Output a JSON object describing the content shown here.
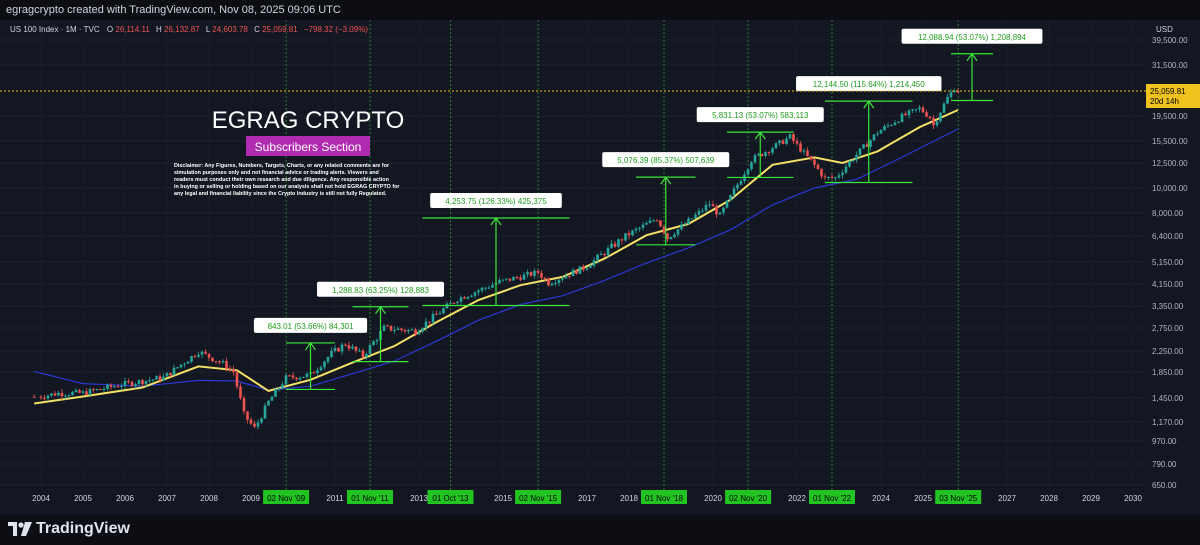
{
  "header": {
    "credit": "egragcrypto created with TradingView.com, Nov 08, 2025 09:06 UTC"
  },
  "legend": {
    "symbol": "US 100 Index · 1M · TVC",
    "o_key": "O",
    "o_val": "26,114.11",
    "h_key": "H",
    "h_val": "26,132.87",
    "l_key": "L",
    "l_val": "24,603.78",
    "c_key": "C",
    "c_val": "25,059.81",
    "chg": "−798.32 (−3.09%)"
  },
  "branding": {
    "title": "EGRAG CRYPTO",
    "badge": "Subscribers Section",
    "disclaimer": [
      "Disclaimer: Any Figures, Numbers, Targets, Charts, or any related comments are for",
      "simulation purposes only and not financial advice or trading alerts. Viewers and",
      "readers must conduct their own research and due diligence. Any responsible action",
      "in buying or selling or holding based on our analysis shall not hold EGRAG CRYPTO for",
      "any legal and financial liability since the Crypto Industry is still not fully Regulated."
    ]
  },
  "footer": {
    "logo_text": "TradingView"
  },
  "colors": {
    "bg": "#131722",
    "up": "#26a69a",
    "down": "#ef5350",
    "ema_fast": "#f5e066",
    "ema_slow": "#2b38d6",
    "measure": "#39e639",
    "vline": "#2f7a2f",
    "price": "#f0c21e"
  },
  "chart_data": {
    "type": "candlestick",
    "symbol": "US 100 Index",
    "interval": "1M",
    "y_scale": "log",
    "currency": "USD",
    "y_ticks": [
      "39,500.00",
      "31,500.00",
      "25,059.81",
      "19,500.00",
      "15,500.00",
      "12,500.00",
      "10,000.00",
      "8,000.00",
      "6,400.00",
      "5,150.00",
      "4,150.00",
      "3,350.00",
      "2,750.00",
      "2,250.00",
      "1,850.00",
      "1,450.00",
      "1,170.00",
      "970.00",
      "790.00",
      "650.00"
    ],
    "x_ticks": [
      "2004",
      "2005",
      "2006",
      "2007",
      "2008",
      "2009",
      "2011",
      "2013",
      "2015",
      "2017",
      "2018",
      "2020",
      "2022",
      "2024",
      "2025",
      "2027",
      "2028",
      "2029",
      "2030"
    ],
    "last_price": {
      "value": "25,059.81",
      "countdown": "20d 14h"
    },
    "close_series": [
      {
        "x": "2003-12",
        "y": 1467
      },
      {
        "x": "2004-06",
        "y": 1516
      },
      {
        "x": "2005-01",
        "y": 1519
      },
      {
        "x": "2005-12",
        "y": 1645
      },
      {
        "x": "2006-12",
        "y": 1756
      },
      {
        "x": "2007-10",
        "y": 2238
      },
      {
        "x": "2008-05",
        "y": 2000
      },
      {
        "x": "2008-08",
        "y": 1850
      },
      {
        "x": "2008-11",
        "y": 1250
      },
      {
        "x": "2009-02",
        "y": 1100
      },
      {
        "x": "2009-06",
        "y": 1400
      },
      {
        "x": "2009-11",
        "y": 1750
      },
      {
        "x": "2010-06",
        "y": 1800
      },
      {
        "x": "2010-12",
        "y": 2200
      },
      {
        "x": "2011-04",
        "y": 2400
      },
      {
        "x": "2011-09",
        "y": 2150
      },
      {
        "x": "2012-03",
        "y": 2750
      },
      {
        "x": "2012-12",
        "y": 2680
      },
      {
        "x": "2013-12",
        "y": 3590
      },
      {
        "x": "2014-12",
        "y": 4240
      },
      {
        "x": "2015-11",
        "y": 4650
      },
      {
        "x": "2016-02",
        "y": 4200
      },
      {
        "x": "2016-12",
        "y": 4860
      },
      {
        "x": "2017-12",
        "y": 6400
      },
      {
        "x": "2018-09",
        "y": 7600
      },
      {
        "x": "2018-12",
        "y": 6300
      },
      {
        "x": "2019-12",
        "y": 8700
      },
      {
        "x": "2020-03",
        "y": 7800
      },
      {
        "x": "2020-12",
        "y": 12900
      },
      {
        "x": "2021-11",
        "y": 16100
      },
      {
        "x": "2022-09",
        "y": 10900
      },
      {
        "x": "2022-12",
        "y": 10950
      },
      {
        "x": "2023-12",
        "y": 16800
      },
      {
        "x": "2024-07",
        "y": 19400
      },
      {
        "x": "2024-12",
        "y": 21000
      },
      {
        "x": "2025-03",
        "y": 19300
      },
      {
        "x": "2025-04",
        "y": 17900
      },
      {
        "x": "2025-08",
        "y": 23400
      },
      {
        "x": "2025-10",
        "y": 25800
      },
      {
        "x": "2025-11",
        "y": 25059.81
      }
    ],
    "ema_fast": [
      {
        "x": "2003-12",
        "y": 1380
      },
      {
        "x": "2005-01",
        "y": 1470
      },
      {
        "x": "2006-06",
        "y": 1600
      },
      {
        "x": "2007-10",
        "y": 1950
      },
      {
        "x": "2008-09",
        "y": 1880
      },
      {
        "x": "2009-06",
        "y": 1550
      },
      {
        "x": "2010-06",
        "y": 1720
      },
      {
        "x": "2011-06",
        "y": 2020
      },
      {
        "x": "2012-06",
        "y": 2350
      },
      {
        "x": "2013-06",
        "y": 2900
      },
      {
        "x": "2014-06",
        "y": 3550
      },
      {
        "x": "2015-06",
        "y": 4100
      },
      {
        "x": "2016-06",
        "y": 4450
      },
      {
        "x": "2017-06",
        "y": 5300
      },
      {
        "x": "2018-06",
        "y": 6450
      },
      {
        "x": "2019-06",
        "y": 7200
      },
      {
        "x": "2020-06",
        "y": 9000
      },
      {
        "x": "2021-06",
        "y": 12300
      },
      {
        "x": "2022-06",
        "y": 13200
      },
      {
        "x": "2023-02",
        "y": 12500
      },
      {
        "x": "2023-12",
        "y": 14000
      },
      {
        "x": "2024-12",
        "y": 17600
      },
      {
        "x": "2025-11",
        "y": 20700
      }
    ],
    "ema_slow": [
      {
        "x": "2003-12",
        "y": 1860
      },
      {
        "x": "2005-01",
        "y": 1660
      },
      {
        "x": "2006-06",
        "y": 1620
      },
      {
        "x": "2007-10",
        "y": 1710
      },
      {
        "x": "2008-09",
        "y": 1700
      },
      {
        "x": "2009-06",
        "y": 1560
      },
      {
        "x": "2010-06",
        "y": 1620
      },
      {
        "x": "2011-06",
        "y": 1820
      },
      {
        "x": "2012-06",
        "y": 2050
      },
      {
        "x": "2013-06",
        "y": 2450
      },
      {
        "x": "2014-06",
        "y": 2950
      },
      {
        "x": "2015-06",
        "y": 3400
      },
      {
        "x": "2016-06",
        "y": 3700
      },
      {
        "x": "2017-06",
        "y": 4300
      },
      {
        "x": "2018-06",
        "y": 5100
      },
      {
        "x": "2019-06",
        "y": 5800
      },
      {
        "x": "2020-06",
        "y": 6800
      },
      {
        "x": "2021-06",
        "y": 8600
      },
      {
        "x": "2022-06",
        "y": 10000
      },
      {
        "x": "2023-06",
        "y": 10800
      },
      {
        "x": "2024-06",
        "y": 13000
      },
      {
        "x": "2025-11",
        "y": 17300
      }
    ],
    "vertical_markers": [
      {
        "date": "2009-11-02",
        "label": "02 Nov '09"
      },
      {
        "date": "2011-11-01",
        "label": "01 Nov '11"
      },
      {
        "date": "2013-10-01",
        "label": "01 Oct '13"
      },
      {
        "date": "2015-11-02",
        "label": "02 Nov '15"
      },
      {
        "date": "2018-11-01",
        "label": "01 Nov '18"
      },
      {
        "date": "2020-11-02",
        "label": "02 Nov '20"
      },
      {
        "date": "2022-11-01",
        "label": "01 Nov '22"
      },
      {
        "date": "2025-11-03",
        "label": "03 Nov '25"
      }
    ],
    "measurements": [
      {
        "label": "843.01 (53.66%) 84,301",
        "x_from": "2009-11",
        "x_to": "2011-01",
        "y_from": 1571,
        "y_to": 2414
      },
      {
        "label": "1,288.83 (63.25%) 128,883",
        "x_from": "2011-06",
        "x_to": "2012-10",
        "y_from": 2038,
        "y_to": 3327
      },
      {
        "label": "4,253.75 (126.33%) 425,375",
        "x_from": "2013-02",
        "x_to": "2016-08",
        "y_from": 3367,
        "y_to": 7621
      },
      {
        "label": "5,076.39 (85.37%) 507,639",
        "x_from": "2018-03",
        "x_to": "2019-08",
        "y_from": 5946,
        "y_to": 11022
      },
      {
        "label": "5,831.13 (53.07%) 583,113",
        "x_from": "2020-05",
        "x_to": "2021-12",
        "y_from": 10988,
        "y_to": 16819
      },
      {
        "label": "12,144.50 (115.64%) 1,214,450",
        "x_from": "2022-09",
        "x_to": "2024-10",
        "y_from": 10502,
        "y_to": 22647
      },
      {
        "label": "12,088.94 (53.07%) 1,208,894",
        "x_from": "2025-09",
        "x_to": "2026-09",
        "y_from": 22779,
        "y_to": 34868
      }
    ]
  }
}
